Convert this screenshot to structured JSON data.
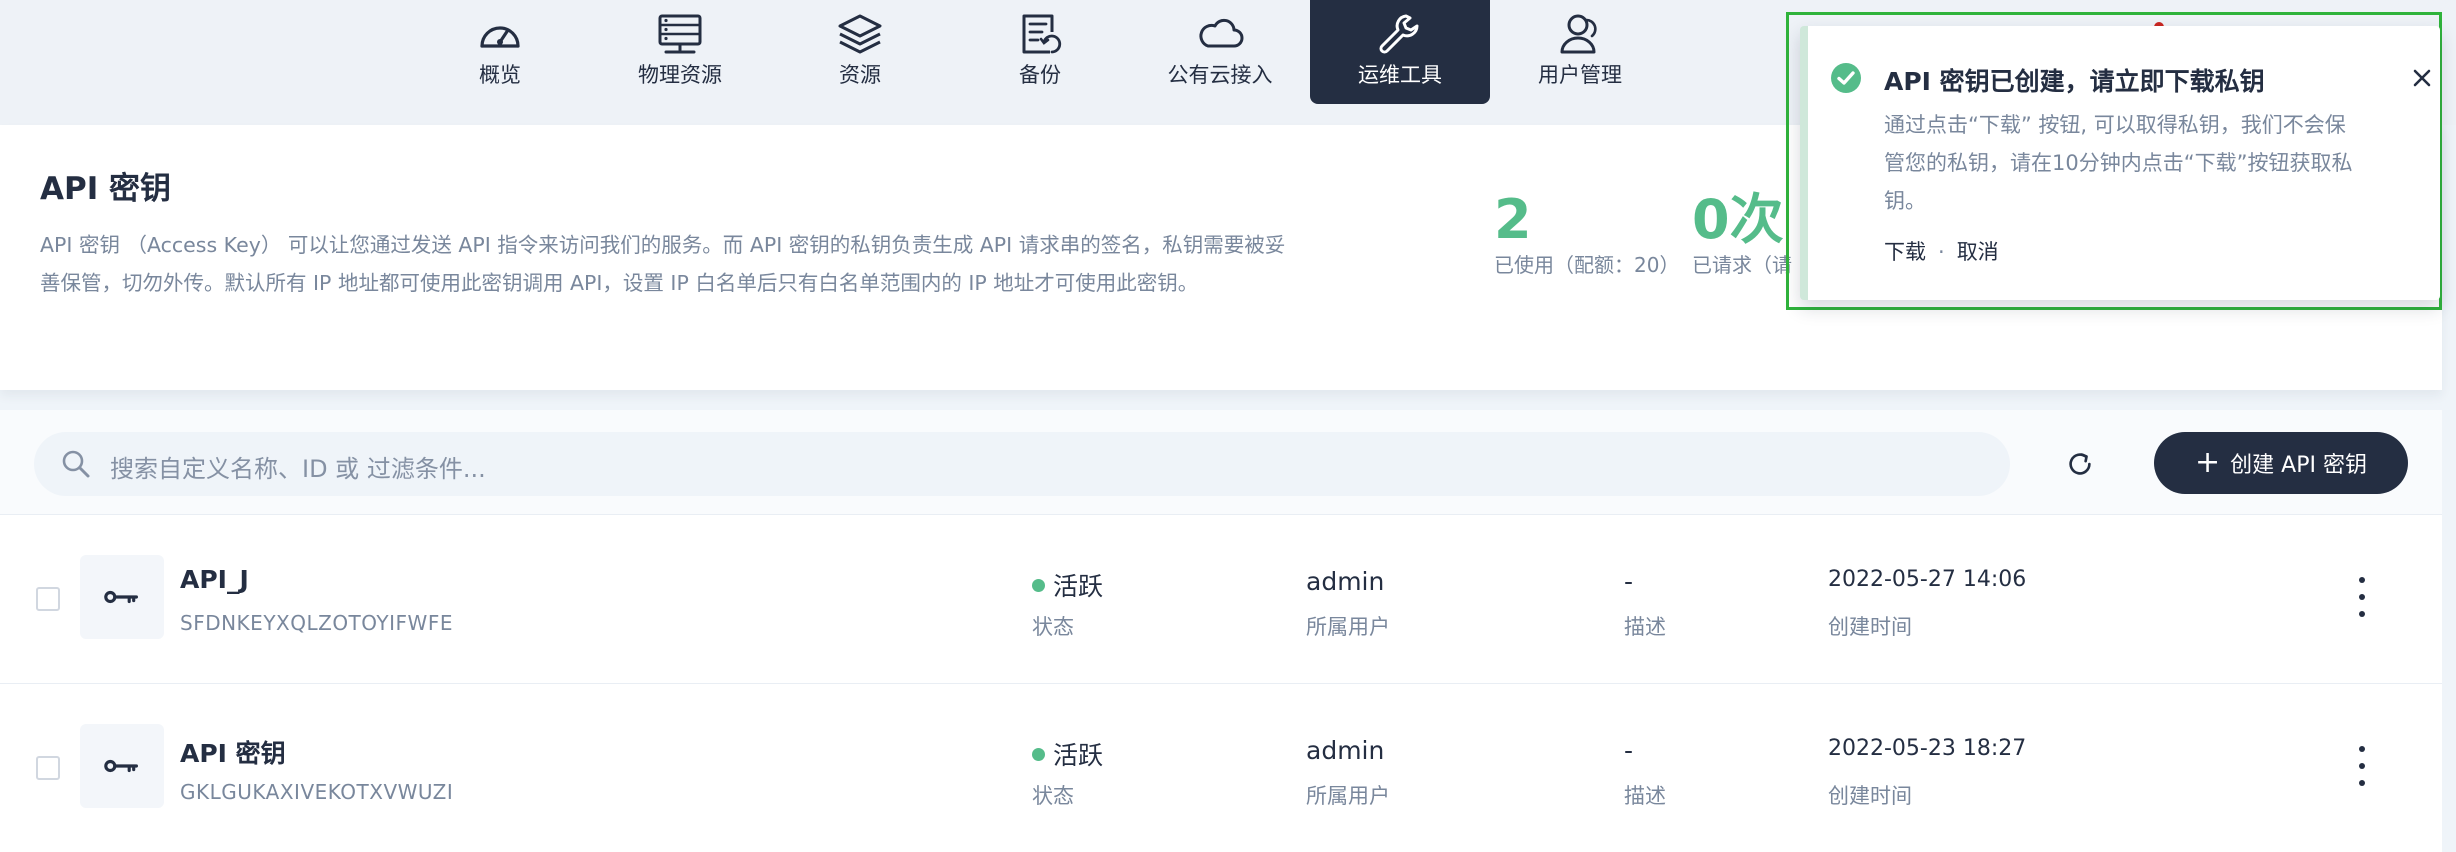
{
  "nav": {
    "items": [
      {
        "label": "概览",
        "icon": "dashboard-icon"
      },
      {
        "label": "物理资源",
        "icon": "server-icon"
      },
      {
        "label": "资源",
        "icon": "layers-icon"
      },
      {
        "label": "备份",
        "icon": "backup-icon"
      },
      {
        "label": "公有云接入",
        "icon": "cloud-icon"
      },
      {
        "label": "运维工具",
        "icon": "wrench-icon",
        "active": true
      },
      {
        "label": "用户管理",
        "icon": "user-management-icon"
      }
    ]
  },
  "page": {
    "title": "API 密钥",
    "description": "API 密钥 （Access Key） 可以让您通过发送 API 指令来访问我们的服务。而 API 密钥的私钥负责生成 API 请求串的签名，私钥需要被妥善保管，切勿外传。默认所有 IP 地址都可使用此密钥调用 API，设置 IP 白名单后只有白名单范围内的 IP 地址才可使用此密钥。"
  },
  "stats": [
    {
      "value": "2",
      "caption": "已使用（配额：20）"
    },
    {
      "value": "0次",
      "caption": "已请求（请"
    }
  ],
  "toolbar": {
    "search_placeholder": "搜索自定义名称、ID 或 过滤条件...",
    "create_label": "创建 API 密钥",
    "create_plus": "+"
  },
  "table": {
    "caps": {
      "status": "状态",
      "owner": "所属用户",
      "desc": "描述",
      "created": "创建时间"
    },
    "rows": [
      {
        "name": "API_J",
        "id": "SFDNKEYXQLZOTOYIFWFE",
        "status": "活跃",
        "owner": "admin",
        "desc": "-",
        "created": "2022-05-27 14:06"
      },
      {
        "name": "API 密钥",
        "id": "GKLGUKAXIVEKOTXVWUZI",
        "status": "活跃",
        "owner": "admin",
        "desc": "-",
        "created": "2022-05-23 18:27"
      }
    ]
  },
  "notification": {
    "title": "API 密钥已创建，请立即下载私钥",
    "body": "通过点击“下载” 按钮, 可以取得私钥，我们不会保管您的私钥，请在10分钟内点击“下载”按钮获取私钥。",
    "download_label": "下载",
    "separator": "·",
    "cancel_label": "取消"
  },
  "colors": {
    "accent": "#242e42",
    "success": "#55bc8a",
    "highlight_outline": "#2fb33b",
    "muted_text": "#79879c"
  }
}
